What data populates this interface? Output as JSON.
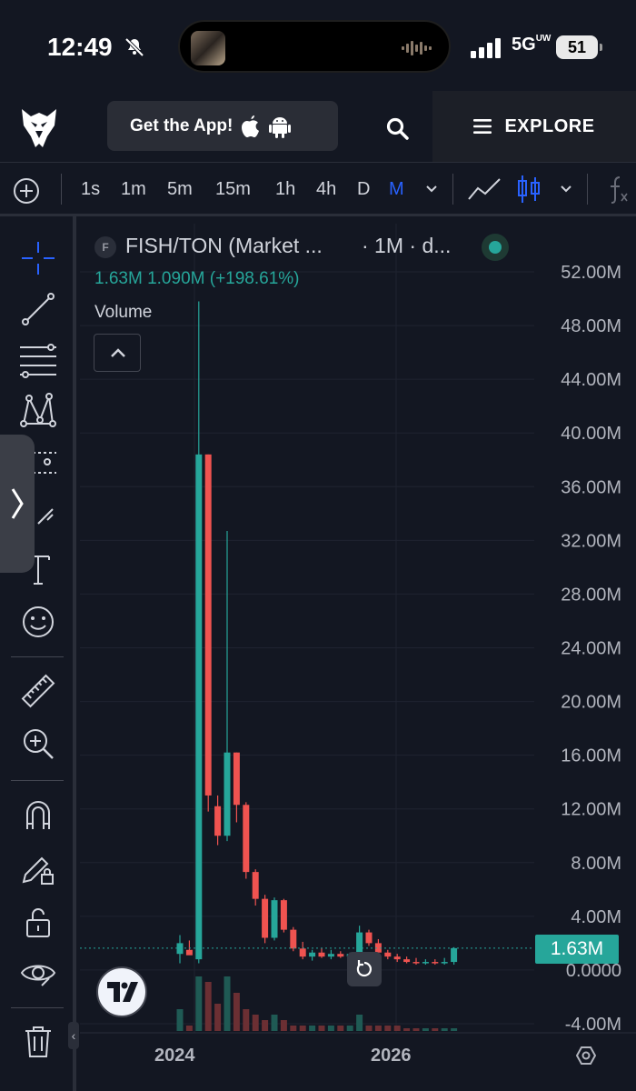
{
  "status_bar": {
    "time": "12:49",
    "network": "5G",
    "network_sub": "UW",
    "battery": "51"
  },
  "header": {
    "get_app_label": "Get the App!",
    "explore_label": "EXPLORE"
  },
  "toolbar": {
    "intervals": [
      "1s",
      "1m",
      "5m",
      "15m",
      "1h",
      "4h",
      "D",
      "M"
    ],
    "active_interval": "M"
  },
  "legend": {
    "symbol_badge": "F",
    "symbol": "FISH/TON (Market ...",
    "timeframe": "· 1M · d...",
    "ohlc_text": "1.63M  1.090M (+198.61%)",
    "volume_label": "Volume"
  },
  "price_tag": "1.63M",
  "colors": {
    "up": "#26a69a",
    "down": "#ef5350",
    "background": "#131722",
    "accent": "#2962ff"
  },
  "chart_data": {
    "type": "candlestick",
    "title": "FISH/TON (Market ...",
    "y_ticks": [
      "52.00M",
      "48.00M",
      "44.00M",
      "40.00M",
      "36.00M",
      "32.00M",
      "28.00M",
      "24.00M",
      "20.00M",
      "16.00M",
      "12.00M",
      "8.00M",
      "4.00M",
      "0.0000",
      "-4.00M"
    ],
    "ylim": [
      -4.0,
      52.0
    ],
    "y_unit": "M",
    "x_ticks": [
      "2024",
      "2026"
    ],
    "last_price": 1.63,
    "candles": [
      {
        "o": 1.2,
        "h": 2.6,
        "l": 0.5,
        "c": 2.0
      },
      {
        "o": 1.5,
        "h": 2.2,
        "l": 1.2,
        "c": 1.1
      },
      {
        "o": 0.8,
        "h": 49.8,
        "l": 0.5,
        "c": 38.4
      },
      {
        "o": 38.4,
        "h": 38.4,
        "l": 11.8,
        "c": 13.0
      },
      {
        "o": 12.2,
        "h": 13.0,
        "l": 9.3,
        "c": 10.0
      },
      {
        "o": 10.0,
        "h": 32.7,
        "l": 9.6,
        "c": 16.2
      },
      {
        "o": 16.2,
        "h": 16.2,
        "l": 11.0,
        "c": 12.3
      },
      {
        "o": 12.3,
        "h": 12.5,
        "l": 6.8,
        "c": 7.3
      },
      {
        "o": 7.3,
        "h": 7.5,
        "l": 4.8,
        "c": 5.3
      },
      {
        "o": 5.3,
        "h": 5.6,
        "l": 2.0,
        "c": 2.4
      },
      {
        "o": 2.4,
        "h": 5.4,
        "l": 2.2,
        "c": 5.2
      },
      {
        "o": 5.2,
        "h": 5.3,
        "l": 2.8,
        "c": 3.0
      },
      {
        "o": 3.0,
        "h": 3.2,
        "l": 1.4,
        "c": 1.6
      },
      {
        "o": 1.6,
        "h": 2.1,
        "l": 0.8,
        "c": 1.0
      },
      {
        "o": 1.0,
        "h": 1.5,
        "l": 0.7,
        "c": 1.3
      },
      {
        "o": 1.3,
        "h": 1.6,
        "l": 0.9,
        "c": 1.0
      },
      {
        "o": 1.0,
        "h": 1.5,
        "l": 0.8,
        "c": 1.2
      },
      {
        "o": 1.2,
        "h": 1.4,
        "l": 0.9,
        "c": 1.0
      },
      {
        "o": 1.0,
        "h": 1.3,
        "l": 0.8,
        "c": 1.2
      },
      {
        "o": 1.2,
        "h": 3.3,
        "l": 1.0,
        "c": 2.8
      },
      {
        "o": 2.8,
        "h": 3.0,
        "l": 1.8,
        "c": 2.0
      },
      {
        "o": 2.0,
        "h": 2.3,
        "l": 1.0,
        "c": 1.3
      },
      {
        "o": 1.3,
        "h": 1.5,
        "l": 0.8,
        "c": 1.0
      },
      {
        "o": 1.0,
        "h": 1.2,
        "l": 0.6,
        "c": 0.8
      },
      {
        "o": 0.8,
        "h": 1.0,
        "l": 0.5,
        "c": 0.6
      },
      {
        "o": 0.6,
        "h": 0.9,
        "l": 0.4,
        "c": 0.5
      },
      {
        "o": 0.5,
        "h": 0.8,
        "l": 0.4,
        "c": 0.6
      },
      {
        "o": 0.6,
        "h": 0.8,
        "l": 0.4,
        "c": 0.5
      },
      {
        "o": 0.5,
        "h": 0.9,
        "l": 0.4,
        "c": 0.6
      },
      {
        "o": 0.6,
        "h": 1.7,
        "l": 0.4,
        "c": 1.63
      }
    ],
    "volumes": [
      4,
      1,
      10,
      9,
      5,
      10,
      7,
      4,
      3,
      2,
      3,
      2,
      1,
      1,
      1,
      1,
      1,
      1,
      1,
      3,
      1,
      1,
      1,
      1,
      0.5,
      0.5,
      0.5,
      0.5,
      0.5,
      0.5
    ]
  }
}
